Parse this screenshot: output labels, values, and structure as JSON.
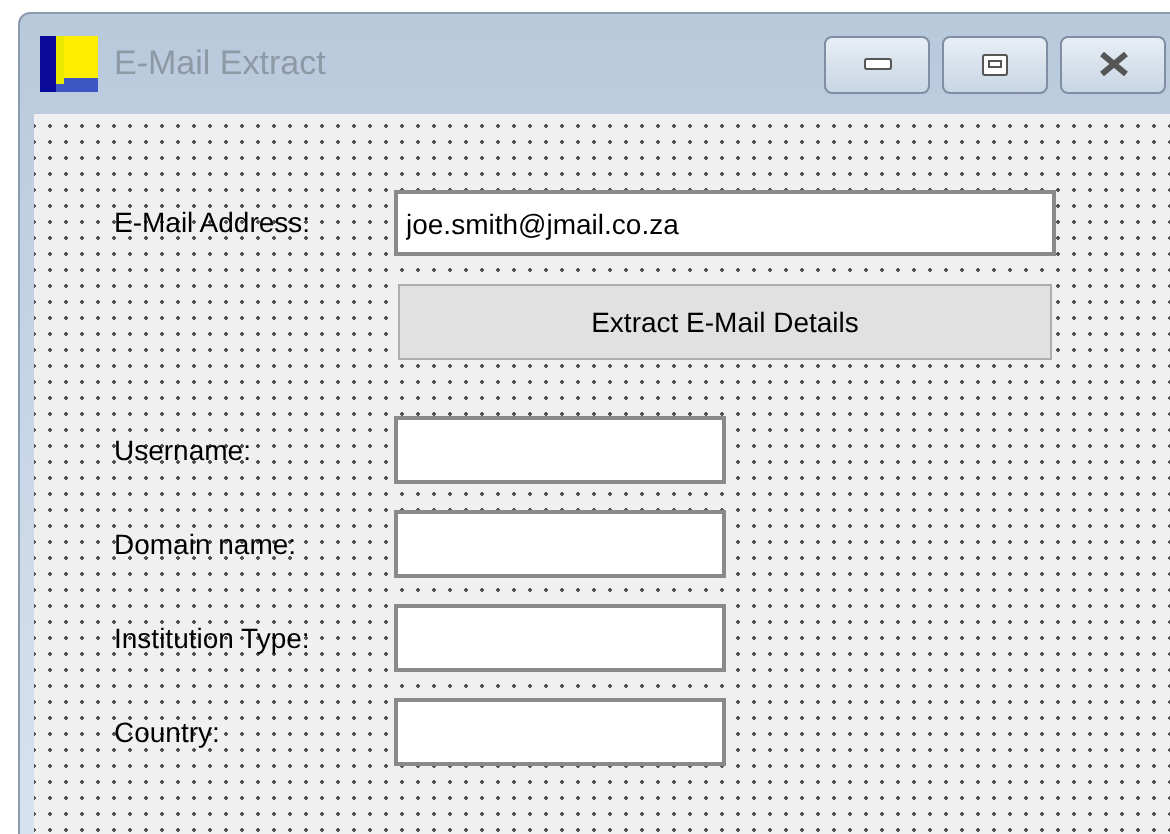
{
  "window": {
    "title": "E-Mail Extract"
  },
  "email": {
    "label": "E-Mail Address:",
    "value": "joe.smith@jmail.co.za"
  },
  "extract_button": {
    "label": "Extract E-Mail Details"
  },
  "fields": [
    {
      "label": "Username:"
    },
    {
      "label": "Domain name:"
    },
    {
      "label": "Institution Type:"
    },
    {
      "label": "Country:"
    }
  ]
}
